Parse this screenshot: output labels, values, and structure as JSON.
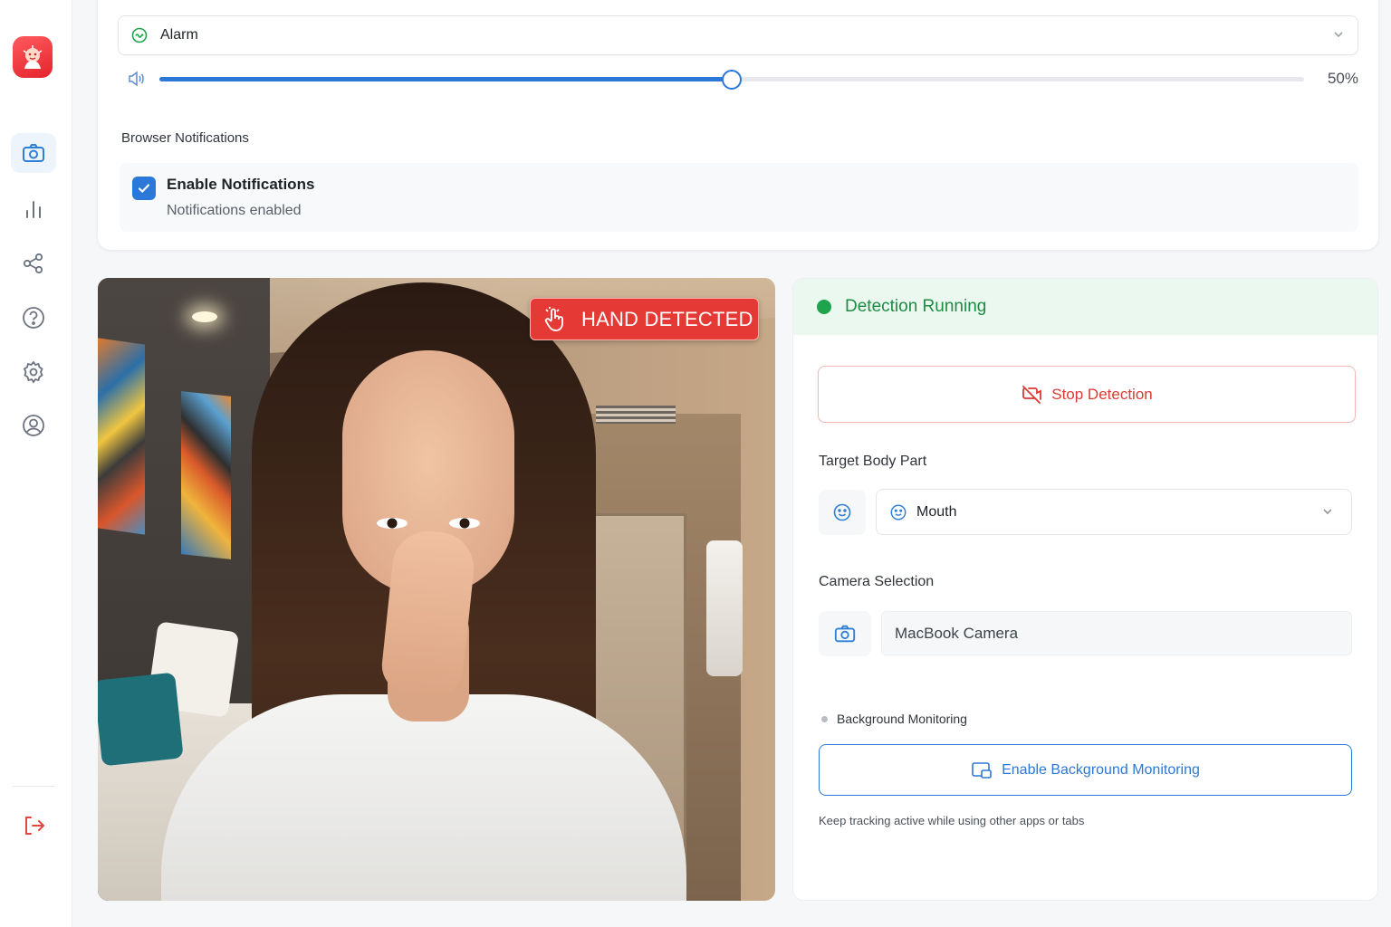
{
  "sidebar": {
    "logo": "app-logo",
    "items": [
      {
        "name": "camera",
        "icon": "camera-icon",
        "active": true
      },
      {
        "name": "stats",
        "icon": "bar-chart-icon",
        "active": false
      },
      {
        "name": "share",
        "icon": "share-icon",
        "active": false
      },
      {
        "name": "help",
        "icon": "help-circle-icon",
        "active": false
      },
      {
        "name": "settings",
        "icon": "gear-icon",
        "active": false
      },
      {
        "name": "profile",
        "icon": "user-circle-icon",
        "active": false
      }
    ],
    "logout_icon": "logout-icon"
  },
  "settings": {
    "sound": {
      "selected": "Alarm"
    },
    "volume": {
      "value": 0.5,
      "label": "50%"
    },
    "browser_notifications_label": "Browser Notifications",
    "notifications": {
      "checked": true,
      "title": "Enable Notifications",
      "subtitle": "Notifications enabled"
    }
  },
  "camera_view": {
    "badge": "HAND DETECTED"
  },
  "panel": {
    "status": "Detection Running",
    "stop_button": "Stop Detection",
    "target_label": "Target Body Part",
    "target_value": "Mouth",
    "camera_label": "Camera Selection",
    "camera_value": "MacBook Camera",
    "background_label": "Background Monitoring",
    "background_button": "Enable Background Monitoring",
    "hint": "Keep tracking active while using other apps or tabs"
  },
  "colors": {
    "accent": "#2b78d8",
    "danger": "#e53935",
    "success": "#1ea44d"
  }
}
